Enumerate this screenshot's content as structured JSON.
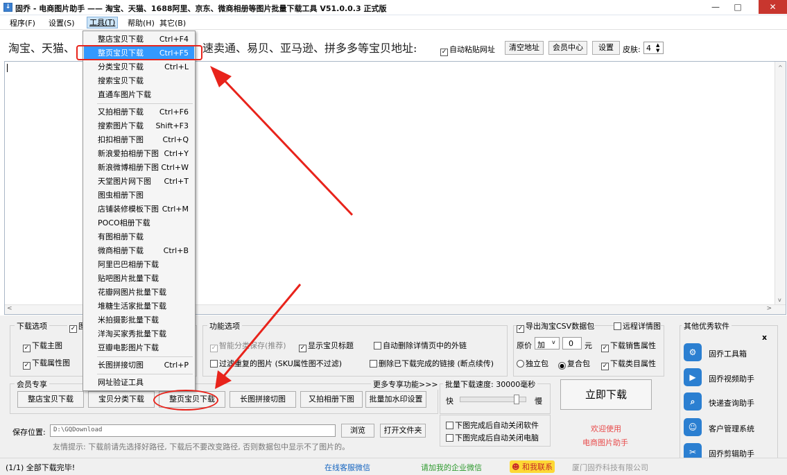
{
  "window": {
    "title": "固乔 - 电商图片助手 —— 淘宝、天猫、1688阿里、京东、微商相册等图片批量下载工具 V51.0.0.3 正式版",
    "app_icon": "download-icon",
    "minimize": "—",
    "maximize": "□",
    "close": "✕"
  },
  "menu": {
    "program": "程序(F)",
    "settings": "设置(S)",
    "tools": "工具(T)",
    "help": "帮助(H)",
    "other": "其它(B)"
  },
  "address_bar": {
    "label_left": "淘宝、天猫、",
    "label_right": "速卖通、易贝、亚马逊、拼多多等宝贝地址:",
    "auto_paste": "自动粘贴网址",
    "auto_paste_checked": true,
    "clear_button": "清空地址",
    "member_button": "会员中心",
    "settings_button": "设置",
    "skin_label": "皮肤:",
    "skin_value": "4"
  },
  "tools_menu": {
    "items": [
      {
        "label": "整店宝贝下载",
        "shortcut": "Ctrl+F4"
      },
      {
        "label": "整页宝贝下载",
        "shortcut": "Ctrl+F5",
        "highlighted": true
      },
      {
        "label": "分类宝贝下载",
        "shortcut": "Ctrl+L"
      },
      {
        "label": "搜索宝贝下载",
        "shortcut": ""
      },
      {
        "label": "直通车图片下载",
        "shortcut": ""
      },
      {
        "label": "又拍相册下载",
        "shortcut": "Ctrl+F6"
      },
      {
        "label": "搜索图片下载",
        "shortcut": "Shift+F3"
      },
      {
        "label": "扣扣相册下图",
        "shortcut": "Ctrl+Q"
      },
      {
        "label": "新浪爱拍相册下图",
        "shortcut": "Ctrl+Y"
      },
      {
        "label": "新浪微博相册下图",
        "shortcut": "Ctrl+W"
      },
      {
        "label": "天堂图片网下图",
        "shortcut": "Ctrl+T"
      },
      {
        "label": "图虫相册下图",
        "shortcut": ""
      },
      {
        "label": "店铺装修模板下图",
        "shortcut": "Ctrl+M"
      },
      {
        "label": "POCO相册下载",
        "shortcut": ""
      },
      {
        "label": "有图相册下载",
        "shortcut": ""
      },
      {
        "label": "微商相册下载",
        "shortcut": "Ctrl+B"
      },
      {
        "label": "阿里巴巴相册下载",
        "shortcut": ""
      },
      {
        "label": "贴吧图片批量下载",
        "shortcut": ""
      },
      {
        "label": "花瓣网图片批量下载",
        "shortcut": ""
      },
      {
        "label": "堆糖生活家批量下载",
        "shortcut": ""
      },
      {
        "label": "米拍摄影批量下载",
        "shortcut": ""
      },
      {
        "label": "洋淘买家秀批量下载",
        "shortcut": ""
      },
      {
        "label": "豆瓣电影图片下载",
        "shortcut": ""
      },
      {
        "label": "长图拼接切图",
        "shortcut": "Ctrl+P"
      },
      {
        "label": "网址验证工具",
        "shortcut": ""
      }
    ]
  },
  "download_options": {
    "title": "下载选项",
    "title_check": "图",
    "main_image": "下载主图",
    "attr_image": "下载属性图"
  },
  "function_options": {
    "title": "功能选项",
    "smart_save": "智能分类保存(推荐)",
    "show_title": "显示宝贝标题",
    "auto_delete_links": "自动删除详情页中的外链",
    "filter_dup": "过滤重复的图片 (SKU属性图不过滤)",
    "delete_done": "删除已下载完成的链接 (断点续传)"
  },
  "export_options": {
    "export_csv": "导出淘宝CSV数据包",
    "remote_detail": "远程详情图",
    "orig_price": "原价",
    "price_op": "加",
    "price_value": "0",
    "price_unit": "元",
    "download_sales_attr": "下载销售属性",
    "independent_pkg": "独立包",
    "composite_pkg": "复合包",
    "download_category_attr": "下载类目属性"
  },
  "member": {
    "title": "会员专享",
    "more": "更多专享功能>>>",
    "buttons": [
      "整店宝贝下载",
      "宝贝分类下载",
      "整页宝贝下载",
      "长图拼接切图",
      "又拍相册下图",
      "批量加水印设置"
    ]
  },
  "speed": {
    "title": "批量下载速度: 30000毫秒",
    "fast": "快",
    "slow": "慢",
    "slider_fraction": 0.9,
    "close_app": "下图完成后自动关闭软件",
    "close_pc": "下图完成后自动关闭电脑"
  },
  "start_button": "立即下载",
  "welcome": {
    "line1": "欢迎使用",
    "line2": "电商图片助手"
  },
  "save": {
    "label": "保存位置:",
    "path": "D:\\GQDownload",
    "browse": "浏览",
    "open_folder": "打开文件夹",
    "hint": "友情提示: 下载前请先选择好路径, 下载后不要改变路径, 否则数据包中显示不了图片的。"
  },
  "other_software": {
    "title": "其他优秀软件",
    "close": "x",
    "items": [
      {
        "label": "固乔工具箱",
        "icon": "toolbox-icon"
      },
      {
        "label": "固乔视频助手",
        "icon": "video-icon"
      },
      {
        "label": "快递查询助手",
        "icon": "express-icon"
      },
      {
        "label": "客户管理系统",
        "icon": "customer-icon"
      },
      {
        "label": "固乔剪辑助手",
        "icon": "edit-icon"
      }
    ]
  },
  "status": {
    "progress": "(1/1) 全部下载完毕!",
    "online_service": "在线客服微信",
    "wechat": "请加我的企业微信",
    "contact": "和我联系",
    "company": "厦门固乔科技有限公司"
  }
}
